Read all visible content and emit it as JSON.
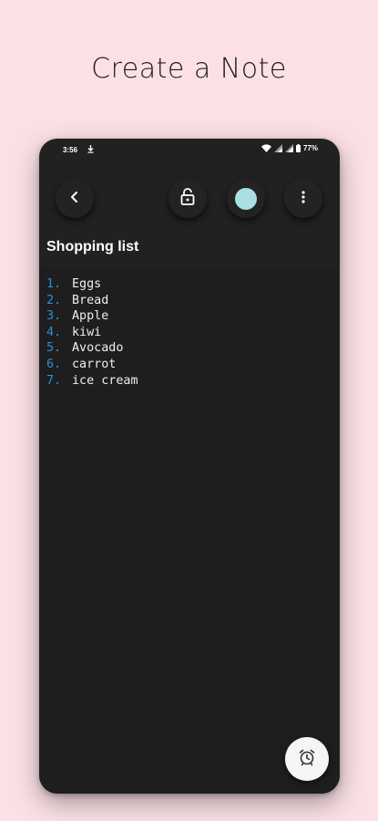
{
  "promo": {
    "title": "Create a Note"
  },
  "status_bar": {
    "time": "3:56",
    "battery": "77%"
  },
  "toolbar": {
    "back_icon": "chevron-left-icon",
    "lock_icon": "lock-icon",
    "color_icon": "color-dot",
    "more_icon": "more-vertical-icon",
    "note_color": "#a9dfe2"
  },
  "note": {
    "title": "Shopping list",
    "items": [
      {
        "num": "1.",
        "text": "Eggs"
      },
      {
        "num": "2.",
        "text": "Bread"
      },
      {
        "num": "3.",
        "text": "Apple"
      },
      {
        "num": "4.",
        "text": "kiwi"
      },
      {
        "num": "5.",
        "text": "Avocado"
      },
      {
        "num": "6.",
        "text": "carrot"
      },
      {
        "num": "7.",
        "text": "ice cream"
      }
    ]
  },
  "fab": {
    "icon": "alarm-clock-icon"
  },
  "colors": {
    "background": "#fbe1e5",
    "phone": "#212121",
    "list_number": "#2f8fd0",
    "note_color": "#a9dfe2"
  }
}
